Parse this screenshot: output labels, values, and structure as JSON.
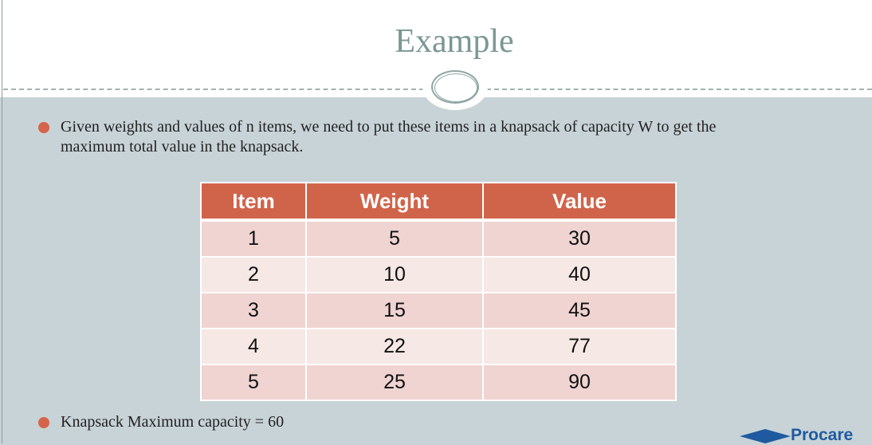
{
  "slide": {
    "title": "Example",
    "bullets": [
      "Given weights and values of n items, we need to put these items in a knapsack of capacity W to get the",
      "maximum total value in the knapsack."
    ],
    "bullet2": "Knapsack Maximum capacity = 60"
  },
  "table": {
    "headers": [
      "Item",
      "Weight",
      "Value"
    ],
    "rows": [
      [
        "1",
        "5",
        "30"
      ],
      [
        "2",
        "10",
        "40"
      ],
      [
        "3",
        "15",
        "45"
      ],
      [
        "4",
        "22",
        "77"
      ],
      [
        "5",
        "25",
        "90"
      ]
    ]
  },
  "logo": {
    "text": "Procare",
    "icon": "graduation-cap-icon"
  },
  "colors": {
    "accent": "#d0644a",
    "title": "#7a9794",
    "background": "#c8d3d7"
  }
}
